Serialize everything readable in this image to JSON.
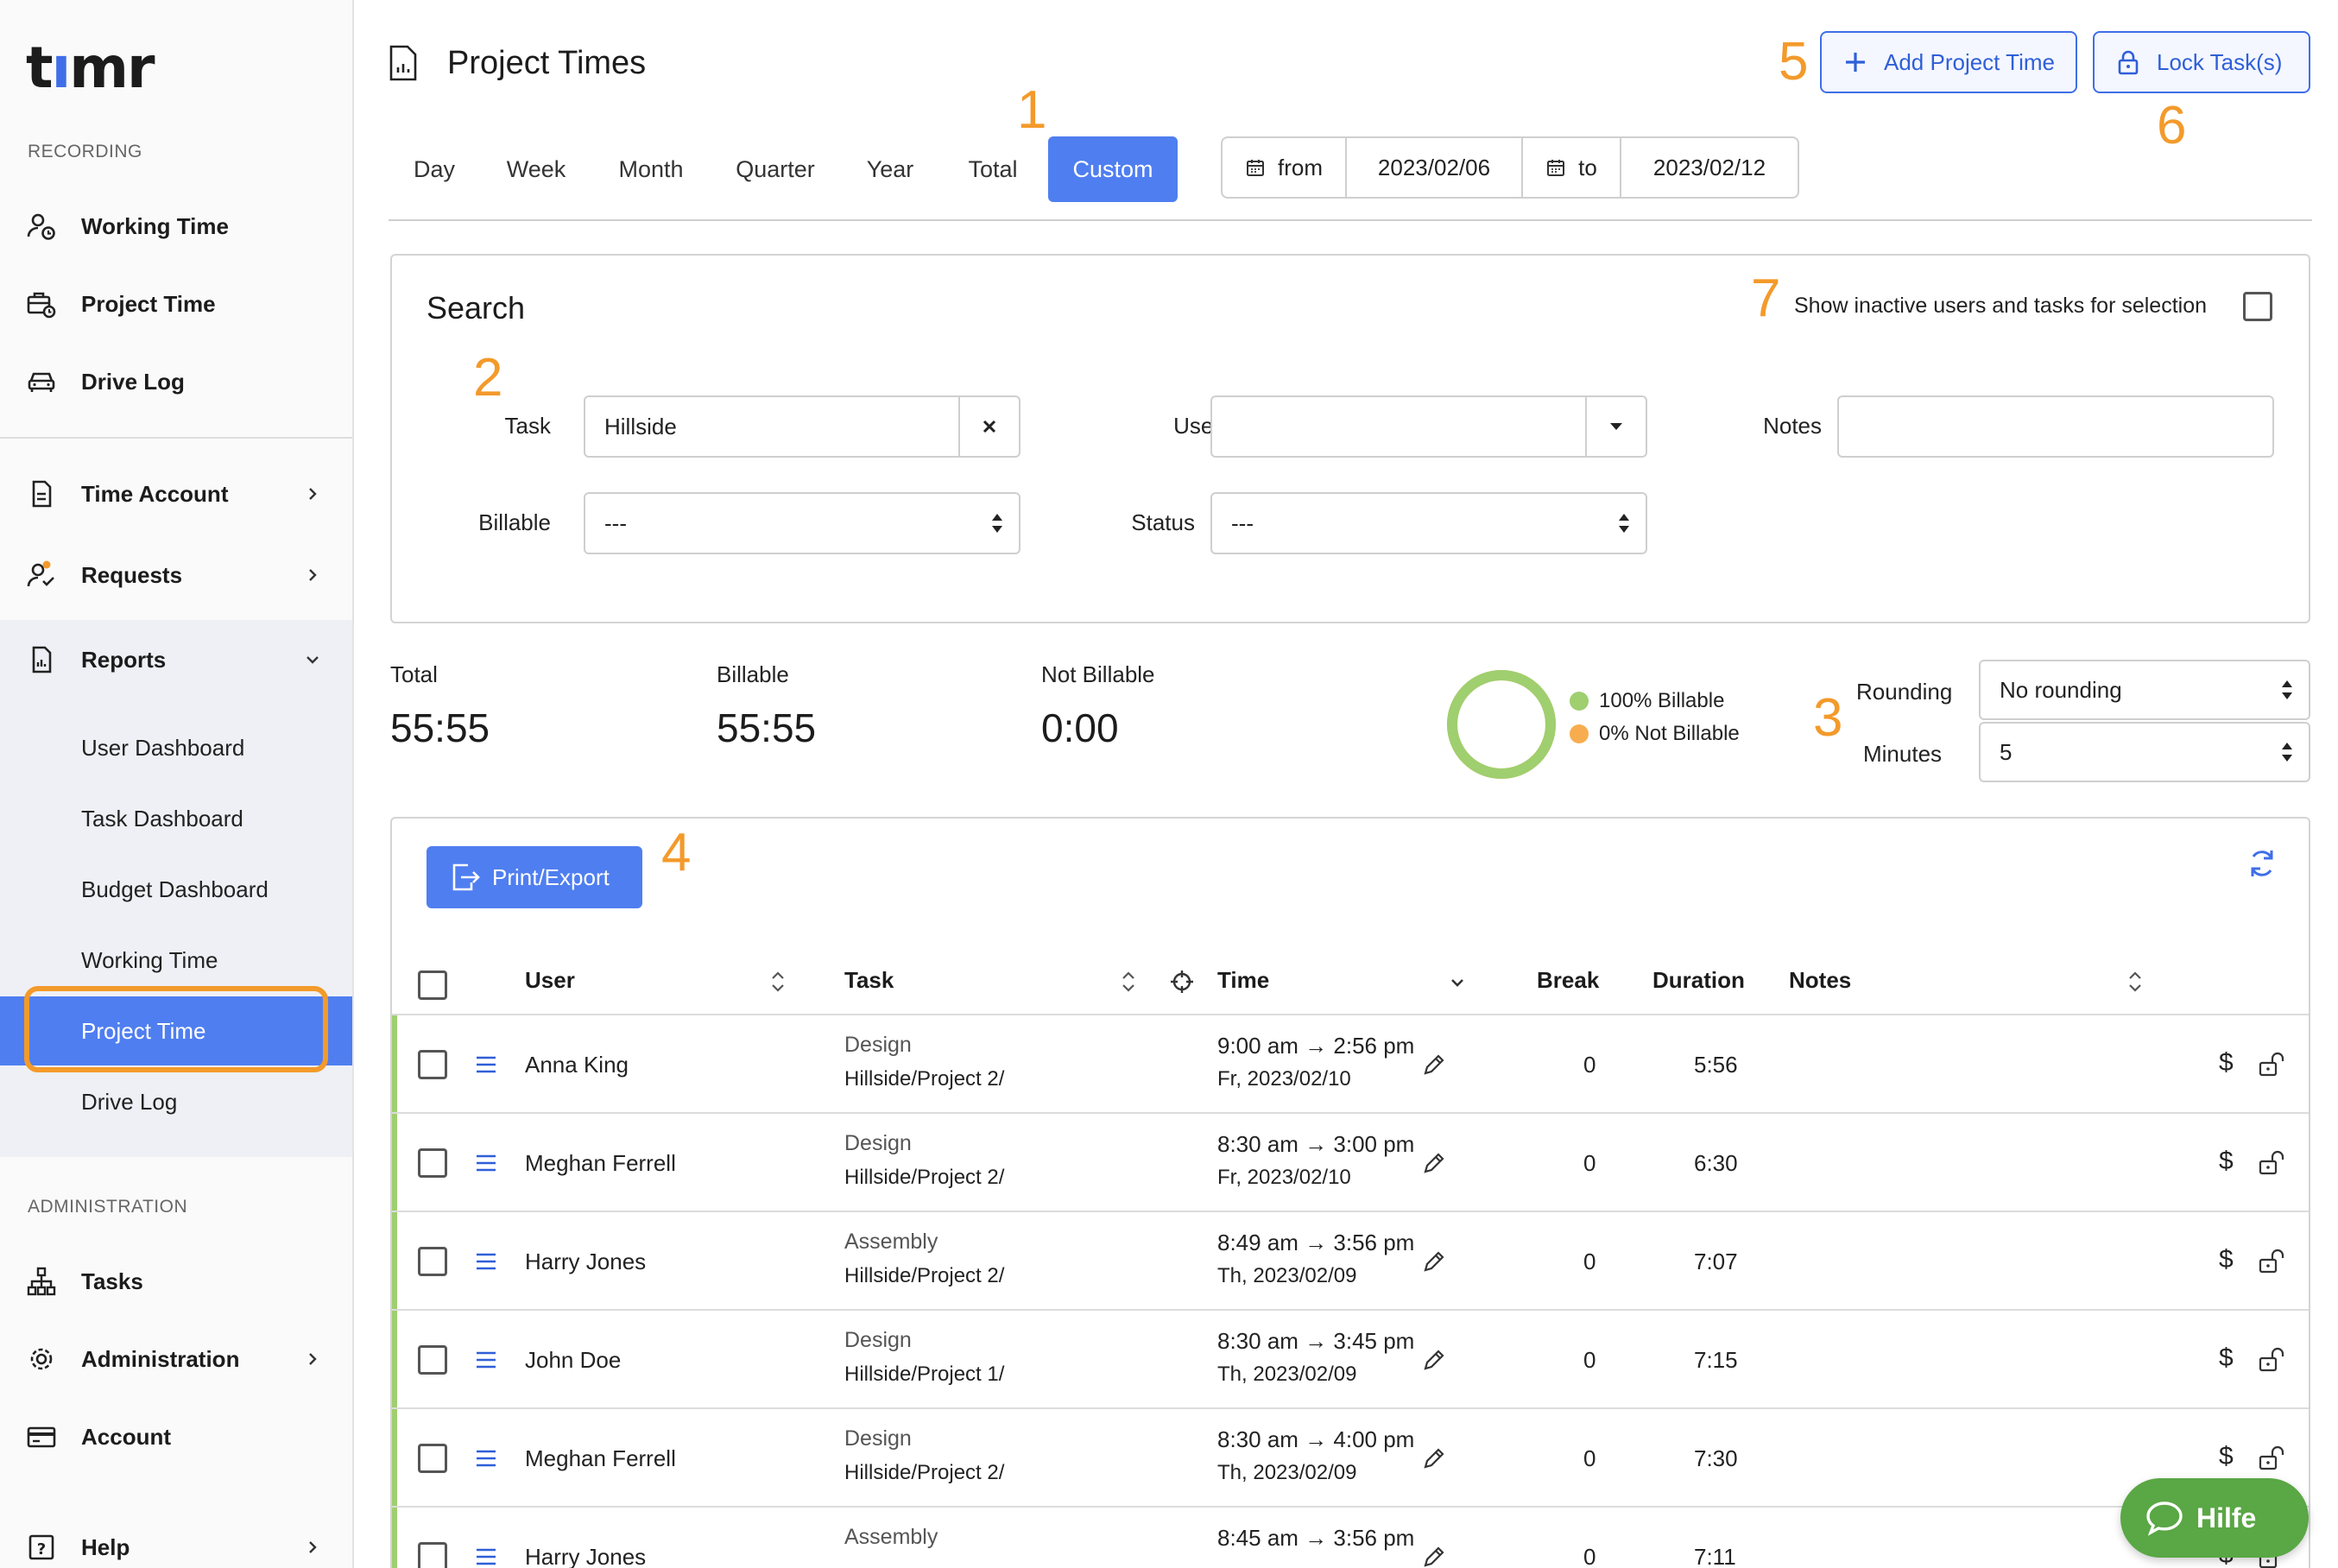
{
  "app": {
    "logo_text": "timr"
  },
  "sidebar": {
    "recording_label": "RECORDING",
    "recording_items": [
      {
        "label": "Working Time",
        "icon": "user-clock-icon"
      },
      {
        "label": "Project Time",
        "icon": "briefcase-clock-icon"
      },
      {
        "label": "Drive Log",
        "icon": "car-icon"
      }
    ],
    "group_items": [
      {
        "label": "Time Account",
        "icon": "document-icon"
      },
      {
        "label": "Requests",
        "icon": "user-check-icon"
      },
      {
        "label": "Reports",
        "icon": "report-icon"
      }
    ],
    "report_subitems": [
      {
        "label": "User Dashboard"
      },
      {
        "label": "Task Dashboard"
      },
      {
        "label": "Budget Dashboard"
      },
      {
        "label": "Working Time"
      },
      {
        "label": "Project Time"
      },
      {
        "label": "Drive Log"
      }
    ],
    "admin_label": "ADMINISTRATION",
    "admin_items": [
      {
        "label": "Tasks",
        "icon": "hierarchy-icon"
      },
      {
        "label": "Administration",
        "icon": "gear-icon"
      },
      {
        "label": "Account",
        "icon": "card-icon"
      },
      {
        "label": "Help",
        "icon": "help-icon"
      }
    ]
  },
  "header": {
    "title": "Project Times",
    "add_button": "Add Project Time",
    "lock_button": "Lock Task(s)"
  },
  "callouts": {
    "c1": "1",
    "c2": "2",
    "c3": "3",
    "c4": "4",
    "c5": "5",
    "c6": "6",
    "c7": "7"
  },
  "tabs": [
    "Day",
    "Week",
    "Month",
    "Quarter",
    "Year",
    "Total",
    "Custom"
  ],
  "date_range": {
    "from_label": "from",
    "from_value": "2023/02/06",
    "to_label": "to",
    "to_value": "2023/02/12"
  },
  "search": {
    "title": "Search",
    "inactive_label": "Show inactive users and tasks for selection",
    "task_label": "Task",
    "task_value": "Hillside",
    "user_label": "User",
    "user_value": "",
    "notes_label": "Notes",
    "notes_value": "",
    "billable_label": "Billable",
    "billable_value": "---",
    "status_label": "Status",
    "status_value": "---"
  },
  "summary": {
    "total_label": "Total",
    "total_value": "55:55",
    "billable_label": "Billable",
    "billable_value": "55:55",
    "not_billable_label": "Not Billable",
    "not_billable_value": "0:00",
    "legend_billable": "100% Billable",
    "legend_not_billable": "0% Not Billable",
    "billable_fraction": 1.0,
    "rounding_label": "Rounding",
    "rounding_value": "No rounding",
    "minutes_label": "Minutes",
    "minutes_value": "5",
    "colors": {
      "billable": "#9fcf6f",
      "not_billable": "#f7ad4f"
    }
  },
  "table": {
    "print_button": "Print/Export",
    "columns": {
      "user": "User",
      "task": "Task",
      "time": "Time",
      "break": "Break",
      "duration": "Duration",
      "notes": "Notes"
    },
    "rows": [
      {
        "user": "Anna King",
        "task": "Design",
        "path": "Hillside/Project 2/",
        "time": "9:00 am → 2:56 pm",
        "date": "Fr, 2023/02/10",
        "break": "0",
        "duration": "5:56"
      },
      {
        "user": "Meghan Ferrell",
        "task": "Design",
        "path": "Hillside/Project 2/",
        "time": "8:30 am → 3:00 pm",
        "date": "Fr, 2023/02/10",
        "break": "0",
        "duration": "6:30"
      },
      {
        "user": "Harry Jones",
        "task": "Assembly",
        "path": "Hillside/Project 2/",
        "time": "8:49 am → 3:56 pm",
        "date": "Th, 2023/02/09",
        "break": "0",
        "duration": "7:07"
      },
      {
        "user": "John Doe",
        "task": "Design",
        "path": "Hillside/Project 1/",
        "time": "8:30 am → 3:45 pm",
        "date": "Th, 2023/02/09",
        "break": "0",
        "duration": "7:15"
      },
      {
        "user": "Meghan Ferrell",
        "task": "Design",
        "path": "Hillside/Project 2/",
        "time": "8:30 am → 4:00 pm",
        "date": "Th, 2023/02/09",
        "break": "0",
        "duration": "7:30"
      },
      {
        "user": "Harry Jones",
        "task": "Assembly",
        "path": "",
        "time": "8:45 am → 3:56 pm",
        "date": "",
        "break": "0",
        "duration": "7:11"
      }
    ]
  },
  "help_button": "Hilfe",
  "colors": {
    "accent": "#4f7ef0",
    "highlight": "#f39a2b",
    "help_green": "#5aa745"
  }
}
